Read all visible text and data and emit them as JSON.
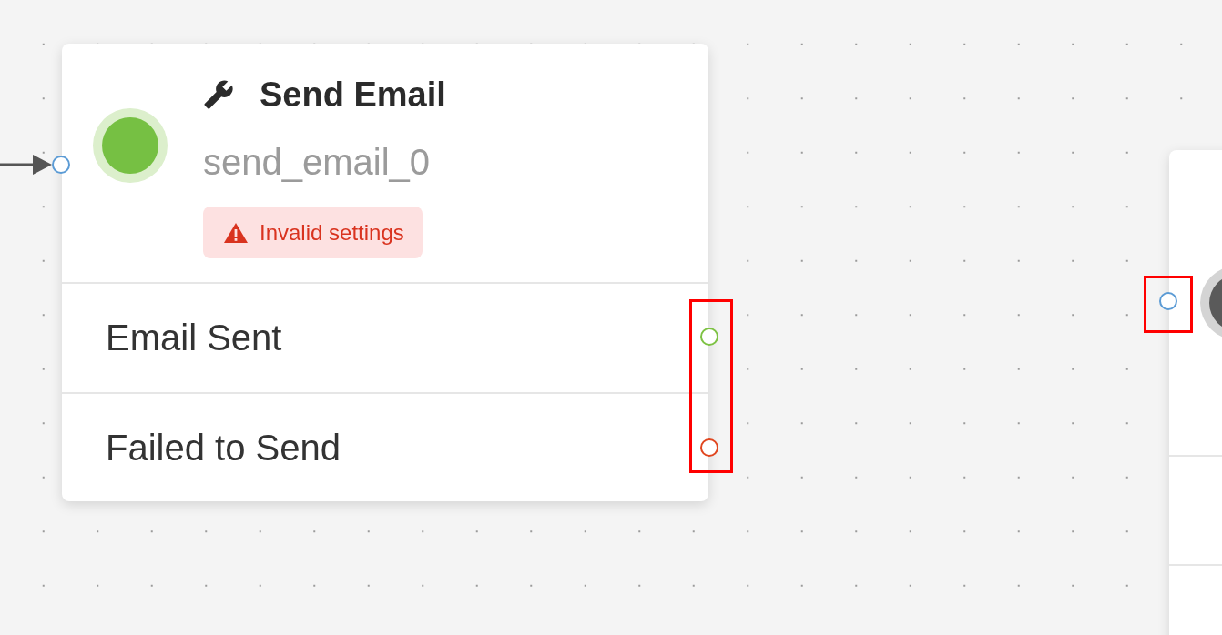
{
  "nodes": [
    {
      "kind": "action",
      "title": "Send Email",
      "id_label": "send_email_0",
      "color": "#76c043",
      "warning": "Invalid settings",
      "input_connected": true,
      "outputs_highlighted": true,
      "outputs": [
        {
          "label": "Email Sent",
          "color": "#7dc243"
        },
        {
          "label": "Failed to Send",
          "color": "#e0461f"
        }
      ]
    },
    {
      "kind": "partial",
      "color": "#5a5a5a",
      "input_highlighted": true
    }
  ]
}
